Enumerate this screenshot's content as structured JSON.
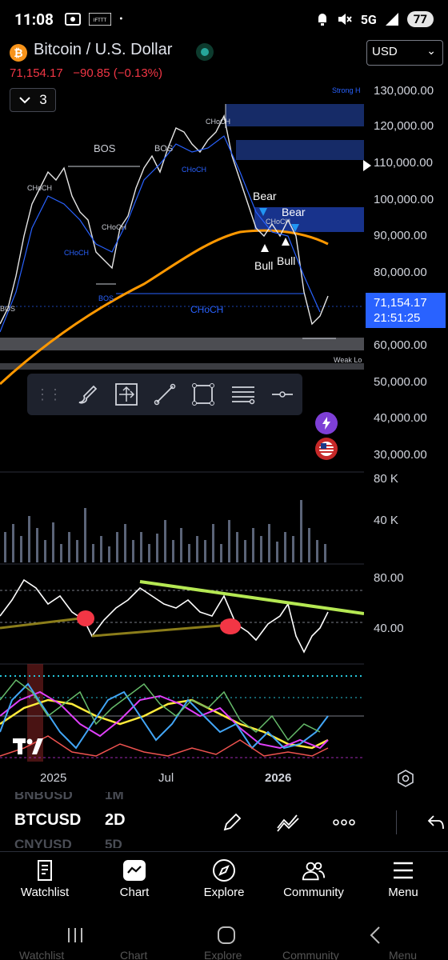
{
  "status_bar": {
    "time": "11:08",
    "network": "5G",
    "battery": "77"
  },
  "header": {
    "symbol_title": "Bitcoin / U.S. Dollar",
    "last_price": "71,154.17",
    "change": "−90.85 (−0.13%)",
    "currency": "USD"
  },
  "indicator_toggle": {
    "count": "3"
  },
  "price_axis": {
    "labels": [
      "130,000.00",
      "120,000.00",
      "110,000.00",
      "100,000.00",
      "90,000.00",
      "80,000.00",
      "60,000.00",
      "50,000.00",
      "40,000.00",
      "30,000.00"
    ],
    "current_price": "71,154.17",
    "countdown": "21:51:25",
    "volume_labels": [
      "80 K",
      "40 K"
    ],
    "rsi_labels": [
      "80.00",
      "40.00"
    ]
  },
  "chart_annotations": {
    "bos_left": "BOS",
    "bos_top": "BOS",
    "bos_mid": "BOS",
    "bos_low": "BOS",
    "choch_1": "CHoCH",
    "choch_2": "CHoCH",
    "choch_3": "CHoCH",
    "choch_4": "CHoCH",
    "choch_5": "CHoCH",
    "choch_6": "CHoCH",
    "choch_big": "CHoCH",
    "bear_1": "Bear",
    "bear_2": "Bear",
    "bull_1": "Bull",
    "bull_2": "Bull",
    "strong_high": "Strong H",
    "weak_low": "Weak Lo"
  },
  "time_axis": {
    "labels": [
      "2025",
      "Jul",
      "2026"
    ]
  },
  "symbol_picker": {
    "ghost_above_symbol": "BNBUSD",
    "ghost_above_interval": "1M",
    "current_symbol": "BTCUSD",
    "current_interval": "2D",
    "ghost_below_symbol": "CNYUSD",
    "ghost_below_interval": "5D"
  },
  "bottom_nav": {
    "items": [
      {
        "label": "Watchlist",
        "icon": "bookmark-icon"
      },
      {
        "label": "Chart",
        "icon": "chart-icon"
      },
      {
        "label": "Explore",
        "icon": "compass-icon"
      },
      {
        "label": "Community",
        "icon": "people-icon"
      },
      {
        "label": "Menu",
        "icon": "menu-icon"
      }
    ]
  },
  "sys_nav_ghost": [
    "Watchlist",
    "Chart",
    "Explore",
    "Community",
    "Menu"
  ],
  "colors": {
    "accent": "#2962ff",
    "negative": "#f23645",
    "ema": "#ff9800",
    "trendline": "#b5e853",
    "supply_zone": "#1e3a8a"
  }
}
